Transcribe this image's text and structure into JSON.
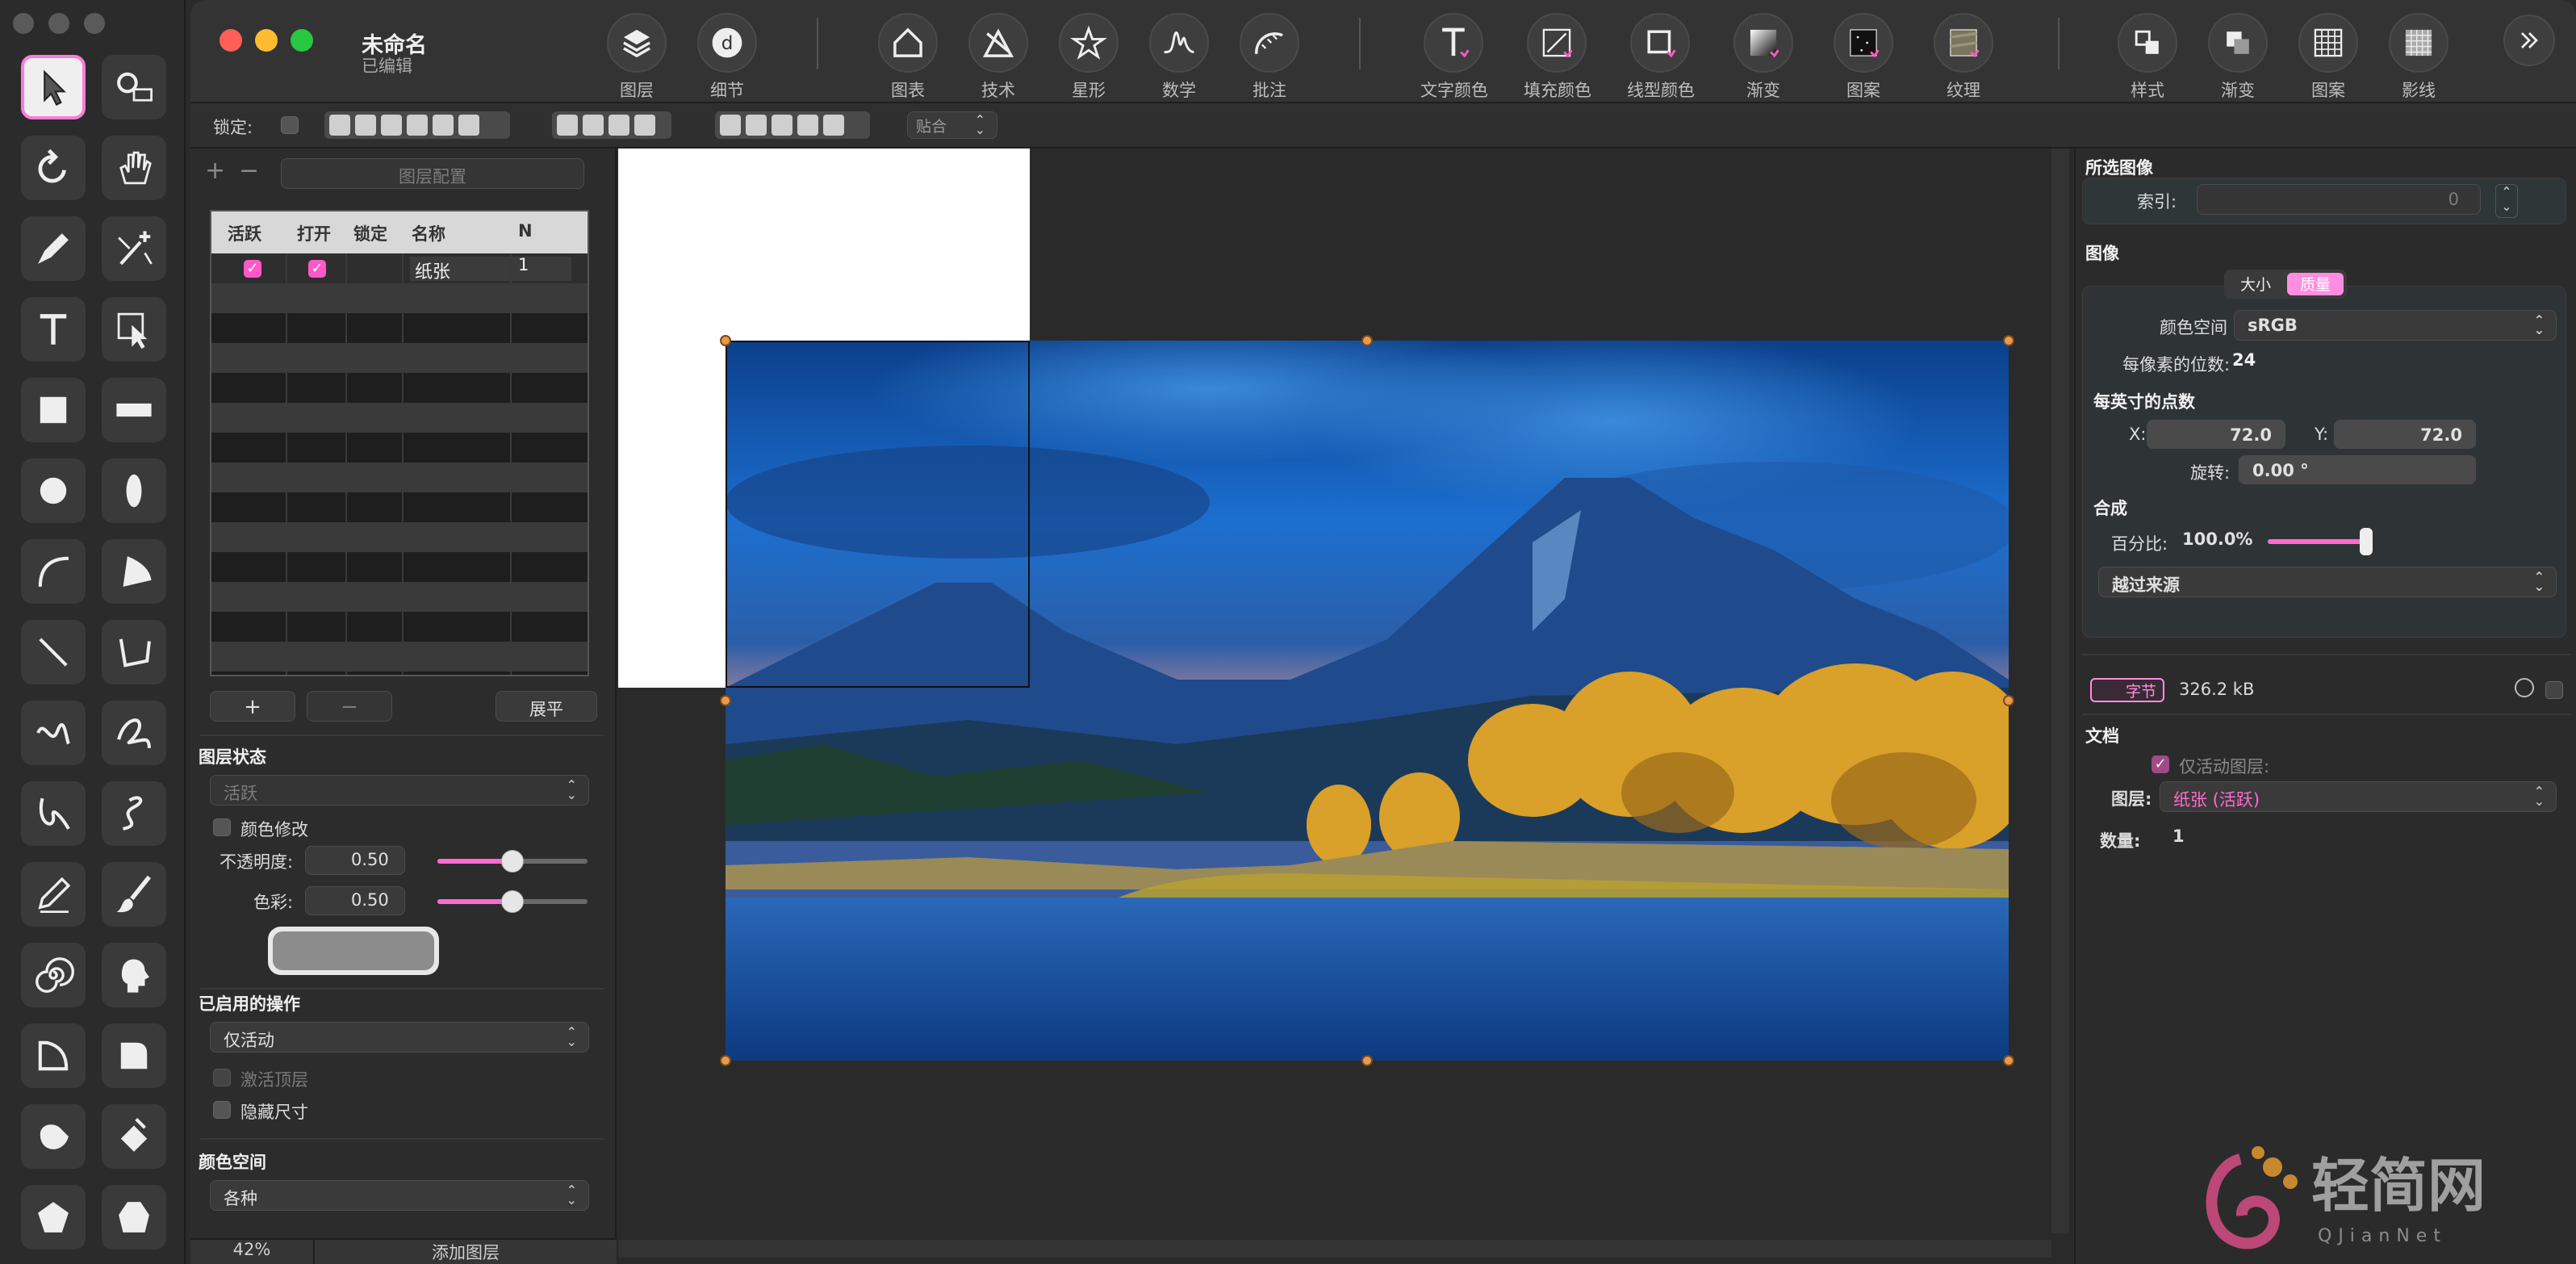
{
  "window": {
    "title": "未命名",
    "subtitle": "已编辑"
  },
  "toolbar": {
    "groups": [
      {
        "items": [
          "图层",
          "细节"
        ]
      },
      {
        "items": [
          "图表",
          "技术",
          "星形",
          "数学",
          "批注"
        ]
      },
      {
        "items": [
          "文字颜色",
          "填充颜色",
          "线型颜色",
          "渐变",
          "图案",
          "纹理"
        ]
      },
      {
        "items": [
          "样式",
          "渐变",
          "图案",
          "影线"
        ]
      }
    ],
    "overflow_icon": "double-chevron-right-icon"
  },
  "optionbar": {
    "lock_label": "锁定:",
    "fit_select": "贴合"
  },
  "layers_panel": {
    "add_icon": "+",
    "remove_icon": "−",
    "config_button": "图层配置",
    "table": {
      "columns": [
        "活跃",
        "打开",
        "锁定",
        "名称",
        "N"
      ],
      "rows": [
        {
          "active": true,
          "open": true,
          "locked": false,
          "name": "纸张",
          "n": "1"
        }
      ]
    },
    "add_button": "+",
    "remove_button": "−",
    "flatten_button": "展平",
    "layer_state_heading": "图层状态",
    "state_select": "活跃",
    "color_modify_label": "颜色修改",
    "opacity_label": "不透明度:",
    "opacity_value": "0.50",
    "opacity_level": 0.5,
    "hue_label": "色彩:",
    "hue_value": "0.50",
    "hue_level": 0.5,
    "enabled_ops_heading": "已启用的操作",
    "ops_select": "仅活动",
    "activate_top_label": "激活顶层",
    "hide_size_label": "隐藏尺寸",
    "colorspace_heading": "颜色空间",
    "colorspace_select": "各种",
    "zoom": "42%",
    "add_layer_button": "添加图层"
  },
  "inspector": {
    "selected_image_heading": "所选图像",
    "index_label": "索引:",
    "index_value": "0",
    "image_heading": "图像",
    "tab_size": "大小",
    "tab_quality": "质量",
    "colorspace_label": "颜色空间",
    "colorspace_value": "sRGB",
    "bits_label": "每像素的位数:",
    "bits_value": "24",
    "dpi_heading": "每英寸的点数",
    "x_label": "X:",
    "x_value": "72.0",
    "y_label": "Y:",
    "y_value": "72.0",
    "rotation_label": "旋转:",
    "rotation_value": "0.00 °",
    "composite_heading": "合成",
    "percent_label": "百分比:",
    "percent_value": "100.0%",
    "percent_level": 1.0,
    "blend_select": "越过来源",
    "bytes_badge": "字节",
    "bytes_value": "326.2 kB",
    "document_heading": "文档",
    "only_active_label": "仅活动图层:",
    "layer_label": "图层:",
    "layer_select": "纸张 (活跃)",
    "count_label": "数量:",
    "count_value": "1"
  },
  "watermark": {
    "text": "轻简网",
    "sub": "QJianNet"
  },
  "colors": {
    "accent": "#ff58c8",
    "handle": "#e89a4a"
  }
}
